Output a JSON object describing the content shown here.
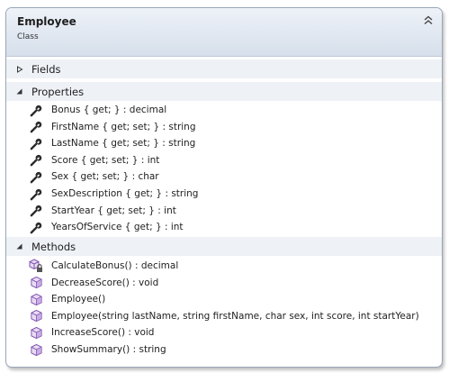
{
  "class": {
    "name": "Employee",
    "kind": "Class"
  },
  "compartments": {
    "fields": {
      "label": "Fields",
      "expanded": false
    },
    "properties": {
      "label": "Properties",
      "expanded": true
    },
    "methods": {
      "label": "Methods",
      "expanded": true
    }
  },
  "properties": [
    {
      "text": "Bonus { get; } : decimal",
      "icon": "wrench-icon"
    },
    {
      "text": "FirstName { get; set; } : string",
      "icon": "wrench-icon"
    },
    {
      "text": "LastName { get; set; } : string",
      "icon": "wrench-icon"
    },
    {
      "text": "Score { get; set; } : int",
      "icon": "wrench-icon"
    },
    {
      "text": "Sex { get; set; } : char",
      "icon": "wrench-icon"
    },
    {
      "text": "SexDescription { get; } : string",
      "icon": "wrench-icon"
    },
    {
      "text": "StartYear { get; set; } : int",
      "icon": "wrench-icon"
    },
    {
      "text": "YearsOfService { get; } : int",
      "icon": "wrench-icon"
    }
  ],
  "methods": [
    {
      "text": "CalculateBonus() : decimal",
      "icon": "private-method-icon"
    },
    {
      "text": "DecreaseScore() : void",
      "icon": "method-cube-icon"
    },
    {
      "text": "Employee()",
      "icon": "method-cube-icon"
    },
    {
      "text": "Employee(string lastName, string firstName, char sex, int score, int startYear)",
      "icon": "method-cube-icon"
    },
    {
      "text": "IncreaseScore() : void",
      "icon": "method-cube-icon"
    },
    {
      "text": "ShowSummary() : string",
      "icon": "method-cube-icon"
    }
  ],
  "colors": {
    "header_gradient_top": "#eef2f8",
    "header_gradient_bottom": "#d6dfeb",
    "border": "#9aa6b8",
    "method_icon": "#8a55b8"
  }
}
